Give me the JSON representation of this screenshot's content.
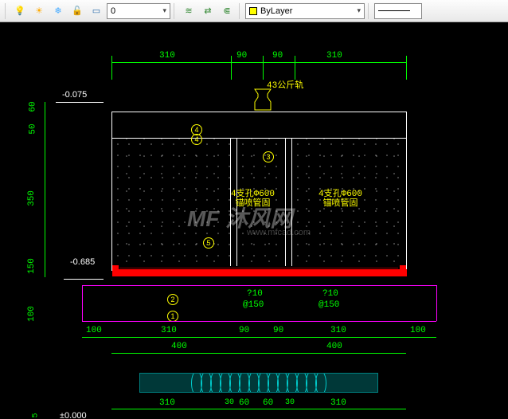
{
  "toolbar": {
    "layer_dropdown_label": "ByLayer",
    "layer_zero": "0"
  },
  "dimensions": {
    "top_row": [
      "310",
      "90",
      "90",
      "310"
    ],
    "left_col": [
      "60",
      "50",
      "350",
      "150",
      "100"
    ],
    "bottom_row": [
      "100",
      "310",
      "90",
      "90",
      "310",
      "100"
    ],
    "bottom_totals": [
      "400",
      "400"
    ],
    "detail_row": [
      "310",
      "30",
      "60",
      "60",
      "30",
      "310"
    ]
  },
  "levels": {
    "top": "-0.075",
    "mid": "-0.685",
    "bottom": "±0.000"
  },
  "labels": {
    "rail": "43公斤轨",
    "left_note": "4支孔Φ600\n锚喷管固",
    "right_note": "4支孔Φ600\n锚喷管固",
    "rebar1_a": "?10",
    "rebar1_b": "@150",
    "rebar2_a": "?10",
    "rebar2_b": "@150"
  },
  "colors": {
    "bylayer_swatch": "#ffff00",
    "dim": "#00ff00",
    "annotation": "#ffff00",
    "detail": "#ff00ff",
    "red": "#ff0000"
  },
  "watermark": {
    "main": "MF 沐风网",
    "sub": "www.mfcad.com"
  }
}
